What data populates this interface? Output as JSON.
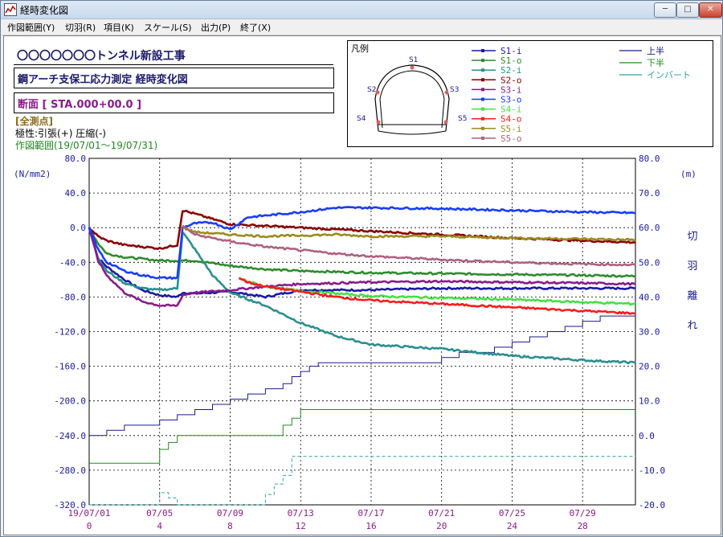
{
  "window": {
    "title": "経時変化図",
    "minimize": "─",
    "maximize": "□",
    "close": "✕"
  },
  "menu": [
    "作図範囲(Y)",
    "切羽(R)",
    "項目(K)",
    "スケール(S)",
    "出力(P)",
    "終了(X)"
  ],
  "header": {
    "project": "〇〇〇〇〇〇〇トンネル新設工事",
    "subtitle": "鋼アーチ支保工応力測定 経時変化図",
    "section": "断面 [ STA.000+00.0 ]",
    "points": "[全測点]",
    "polarity": "極性:引張(+)  圧縮(-)",
    "range": "作図範囲(19/07/01～19/07/31)"
  },
  "legend": {
    "title": "凡例",
    "diagram_labels": [
      "S1",
      "S2",
      "S3",
      "S4",
      "S5"
    ],
    "series": [
      {
        "name": "S1-i",
        "color": "#1a1aa6"
      },
      {
        "name": "S1-o",
        "color": "#2e8b2e"
      },
      {
        "name": "S2-i",
        "color": "#2a8f8f"
      },
      {
        "name": "S2-o",
        "color": "#8b0000"
      },
      {
        "name": "S3-i",
        "color": "#8b1a8b"
      },
      {
        "name": "S3-o",
        "color": "#1a3cff"
      },
      {
        "name": "S4-i",
        "color": "#44e044"
      },
      {
        "name": "S4-o",
        "color": "#ff1a1a"
      },
      {
        "name": "S5-i",
        "color": "#9a8c1e"
      },
      {
        "name": "S5-o",
        "color": "#b06080"
      }
    ],
    "face": [
      {
        "name": "上半",
        "color": "#1a1a8c"
      },
      {
        "name": "下半",
        "color": "#228b22"
      },
      {
        "name": "インバート",
        "color": "#2aa0a0"
      }
    ]
  },
  "chart_data": {
    "type": "line",
    "y_left_unit": "(N/mm2)",
    "y_right_unit": "(m)",
    "y_right_label": [
      "切",
      "羽",
      "離",
      "れ"
    ],
    "y_left_ticks": [
      "80.0",
      "40.0",
      "0.0",
      "-40.0",
      "-80.0",
      "-120.0",
      "-160.0",
      "-200.0",
      "-240.0",
      "-280.0",
      "-320.0"
    ],
    "y_right_ticks": [
      "80.0",
      "70.0",
      "60.0",
      "50.0",
      "40.0",
      "30.0",
      "20.0",
      "10.0",
      "0.0",
      "-10.0",
      "-20.0"
    ],
    "ylim_left": [
      -320,
      80
    ],
    "ylim_right": [
      -20,
      80
    ],
    "xlim": [
      0,
      31
    ],
    "x_ticks": [
      0,
      4,
      8,
      12,
      16,
      20,
      24,
      28
    ],
    "x_date_labels": [
      "19/07/01",
      "07/05",
      "07/09",
      "07/13",
      "07/17",
      "07/21",
      "07/25",
      "07/29"
    ],
    "x_day_labels": [
      "0",
      "4",
      "8",
      "12",
      "16",
      "20",
      "24",
      "28"
    ],
    "grid": true,
    "stress_series": [
      {
        "name": "S1-i",
        "color": "#1a1aa6",
        "points": [
          [
            0,
            0
          ],
          [
            0.5,
            -35
          ],
          [
            1,
            -45
          ],
          [
            2,
            -60
          ],
          [
            3,
            -72
          ],
          [
            4,
            -78
          ],
          [
            5,
            -80
          ],
          [
            5.3,
            -75
          ],
          [
            6,
            -76
          ],
          [
            8,
            -74
          ],
          [
            10,
            -80
          ],
          [
            12,
            -72
          ],
          [
            16,
            -72
          ],
          [
            20,
            -70
          ],
          [
            24,
            -70
          ],
          [
            28,
            -70
          ],
          [
            31,
            -70
          ]
        ]
      },
      {
        "name": "S1-o",
        "color": "#2e8b2e",
        "points": [
          [
            0,
            0
          ],
          [
            0.5,
            -18
          ],
          [
            1,
            -30
          ],
          [
            2,
            -34
          ],
          [
            3,
            -36
          ],
          [
            4,
            -38
          ],
          [
            5,
            -38
          ],
          [
            6,
            -38
          ],
          [
            8,
            -44
          ],
          [
            10,
            -48
          ],
          [
            12,
            -50
          ],
          [
            16,
            -52
          ],
          [
            20,
            -53
          ],
          [
            24,
            -54
          ],
          [
            28,
            -55
          ],
          [
            31,
            -56
          ]
        ]
      },
      {
        "name": "S2-i",
        "color": "#2a8f8f",
        "points": [
          [
            0,
            0
          ],
          [
            0.5,
            -35
          ],
          [
            1,
            -50
          ],
          [
            2,
            -64
          ],
          [
            3,
            -70
          ],
          [
            4,
            -72
          ],
          [
            5,
            -70
          ],
          [
            5.3,
            -5
          ],
          [
            6,
            -25
          ],
          [
            7,
            -55
          ],
          [
            8,
            -75
          ],
          [
            10,
            -90
          ],
          [
            12,
            -110
          ],
          [
            14,
            -125
          ],
          [
            16,
            -135
          ],
          [
            20,
            -140
          ],
          [
            24,
            -148
          ],
          [
            28,
            -153
          ],
          [
            31,
            -156
          ]
        ]
      },
      {
        "name": "S2-o",
        "color": "#8b0000",
        "points": [
          [
            0,
            0
          ],
          [
            0.5,
            -10
          ],
          [
            1,
            -15
          ],
          [
            2,
            -20
          ],
          [
            3,
            -22
          ],
          [
            4,
            -24
          ],
          [
            5,
            -20
          ],
          [
            5.3,
            20
          ],
          [
            6,
            16
          ],
          [
            7,
            10
          ],
          [
            8,
            4
          ],
          [
            10,
            2
          ],
          [
            12,
            0
          ],
          [
            16,
            -4
          ],
          [
            20,
            -8
          ],
          [
            24,
            -12
          ],
          [
            28,
            -15
          ],
          [
            31,
            -17
          ]
        ]
      },
      {
        "name": "S3-i",
        "color": "#8b1a8b",
        "points": [
          [
            0,
            0
          ],
          [
            0.5,
            -38
          ],
          [
            1,
            -55
          ],
          [
            2,
            -75
          ],
          [
            3,
            -85
          ],
          [
            4,
            -90
          ],
          [
            5,
            -90
          ],
          [
            5.3,
            -78
          ],
          [
            6,
            -75
          ],
          [
            8,
            -72
          ],
          [
            10,
            -68
          ],
          [
            12,
            -65
          ],
          [
            16,
            -63
          ],
          [
            20,
            -62
          ],
          [
            24,
            -63
          ],
          [
            28,
            -64
          ],
          [
            31,
            -65
          ]
        ]
      },
      {
        "name": "S3-o",
        "color": "#1a3cff",
        "points": [
          [
            0,
            0
          ],
          [
            0.5,
            -25
          ],
          [
            1,
            -40
          ],
          [
            2,
            -50
          ],
          [
            3,
            -55
          ],
          [
            4,
            -58
          ],
          [
            5,
            -58
          ],
          [
            5.3,
            0
          ],
          [
            6,
            5
          ],
          [
            7,
            6
          ],
          [
            8,
            -2
          ],
          [
            9,
            12
          ],
          [
            12,
            18
          ],
          [
            14,
            23
          ],
          [
            16,
            23
          ],
          [
            20,
            22
          ],
          [
            24,
            20
          ],
          [
            28,
            18
          ],
          [
            31,
            17
          ]
        ]
      },
      {
        "name": "S4-i",
        "color": "#44e044",
        "points": [
          [
            8.5,
            -58
          ],
          [
            9,
            -62
          ],
          [
            10,
            -68
          ],
          [
            12,
            -73
          ],
          [
            14,
            -76
          ],
          [
            16,
            -79
          ],
          [
            20,
            -81
          ],
          [
            24,
            -83
          ],
          [
            28,
            -86
          ],
          [
            31,
            -88
          ]
        ]
      },
      {
        "name": "S4-o",
        "color": "#ff1a1a",
        "points": [
          [
            8.5,
            -58
          ],
          [
            9,
            -63
          ],
          [
            10,
            -68
          ],
          [
            12,
            -74
          ],
          [
            14,
            -80
          ],
          [
            16,
            -84
          ],
          [
            20,
            -88
          ],
          [
            24,
            -92
          ],
          [
            28,
            -96
          ],
          [
            31,
            -99
          ]
        ]
      },
      {
        "name": "S5-i",
        "color": "#9a8c1e",
        "points": [
          [
            5.3,
            0
          ],
          [
            6,
            -5
          ],
          [
            8,
            -8
          ],
          [
            10,
            -10
          ],
          [
            12,
            -9
          ],
          [
            14,
            -8
          ],
          [
            16,
            -10
          ],
          [
            20,
            -10
          ],
          [
            24,
            -12
          ],
          [
            28,
            -13
          ],
          [
            31,
            -14
          ]
        ]
      },
      {
        "name": "S5-o",
        "color": "#b06080",
        "points": [
          [
            5.3,
            2
          ],
          [
            6,
            -8
          ],
          [
            8,
            -16
          ],
          [
            10,
            -22
          ],
          [
            12,
            -26
          ],
          [
            14,
            -30
          ],
          [
            16,
            -33
          ],
          [
            20,
            -37
          ],
          [
            24,
            -40
          ],
          [
            28,
            -42
          ],
          [
            31,
            -43
          ]
        ]
      }
    ],
    "face_series": [
      {
        "name": "上半",
        "color": "#1a1a8c",
        "dash": "",
        "points": [
          [
            0,
            0
          ],
          [
            1,
            0
          ],
          [
            1,
            1.5
          ],
          [
            2,
            1.5
          ],
          [
            2,
            3
          ],
          [
            4,
            3
          ],
          [
            4,
            4.5
          ],
          [
            5,
            4.5
          ],
          [
            5,
            6
          ],
          [
            6,
            6
          ],
          [
            6,
            7.5
          ],
          [
            7,
            7.5
          ],
          [
            7,
            9
          ],
          [
            8,
            9
          ],
          [
            8,
            10.5
          ],
          [
            9,
            10.5
          ],
          [
            9,
            12
          ],
          [
            10,
            12
          ],
          [
            10,
            13.5
          ],
          [
            11,
            13.5
          ],
          [
            11,
            15
          ],
          [
            11.5,
            15
          ],
          [
            11.5,
            17
          ],
          [
            12,
            17
          ],
          [
            12,
            18.5
          ],
          [
            12.5,
            18.5
          ],
          [
            12.5,
            20
          ],
          [
            13,
            20
          ],
          [
            13,
            21
          ],
          [
            20,
            21
          ],
          [
            20,
            22.5
          ],
          [
            21,
            22.5
          ],
          [
            21,
            24
          ],
          [
            23,
            24
          ],
          [
            23,
            25.5
          ],
          [
            24,
            25.5
          ],
          [
            24,
            27
          ],
          [
            25,
            27
          ],
          [
            25,
            28.5
          ],
          [
            26,
            28.5
          ],
          [
            26,
            30
          ],
          [
            27,
            30
          ],
          [
            27,
            31.5
          ],
          [
            28,
            31.5
          ],
          [
            28,
            33
          ],
          [
            29,
            33
          ],
          [
            29,
            34.5
          ],
          [
            31,
            34.5
          ]
        ]
      },
      {
        "name": "下半",
        "color": "#228b22",
        "dash": "",
        "points": [
          [
            0,
            -8
          ],
          [
            4,
            -8
          ],
          [
            4,
            -4
          ],
          [
            4.5,
            -4
          ],
          [
            4.5,
            -2
          ],
          [
            5,
            -2
          ],
          [
            5,
            0
          ],
          [
            11,
            0
          ],
          [
            11,
            3
          ],
          [
            11.5,
            3
          ],
          [
            11.5,
            5
          ],
          [
            12,
            5
          ],
          [
            12,
            7.5
          ],
          [
            31,
            7.5
          ]
        ]
      },
      {
        "name": "インバート",
        "color": "#2aa0a0",
        "dash": "4,3",
        "points": [
          [
            0,
            -20
          ],
          [
            4,
            -20
          ],
          [
            4,
            -16.5
          ],
          [
            4.5,
            -16.5
          ],
          [
            4.5,
            -18
          ],
          [
            5,
            -18
          ],
          [
            5,
            -20
          ],
          [
            10,
            -20
          ],
          [
            10,
            -17
          ],
          [
            10.5,
            -17
          ],
          [
            10.5,
            -14
          ],
          [
            11,
            -14
          ],
          [
            11,
            -11.5
          ],
          [
            11.5,
            -11.5
          ],
          [
            11.5,
            -6
          ],
          [
            31,
            -6
          ]
        ]
      }
    ]
  }
}
